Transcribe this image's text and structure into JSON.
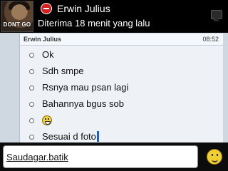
{
  "header": {
    "avatar_logo": "DONT GO",
    "contact_name": "Erwin Julius",
    "status_text": "Diterima 18 menit yang lalu",
    "status_icon": "do-not-disturb-icon"
  },
  "chat": {
    "sender": "Erwin Julius",
    "time": "08:52",
    "messages": [
      {
        "text": "Ok"
      },
      {
        "text": "Sdh smpe"
      },
      {
        "text": "Rsnya mau psan lagi"
      },
      {
        "text": "Bahannya bgus sob"
      },
      {
        "text": "",
        "icon": "smiley-emoticon-icon"
      },
      {
        "text": "Sesuai d foto"
      }
    ]
  },
  "composer": {
    "value": "Saudagar.batik",
    "emoji_icon": "smiley-icon"
  }
}
